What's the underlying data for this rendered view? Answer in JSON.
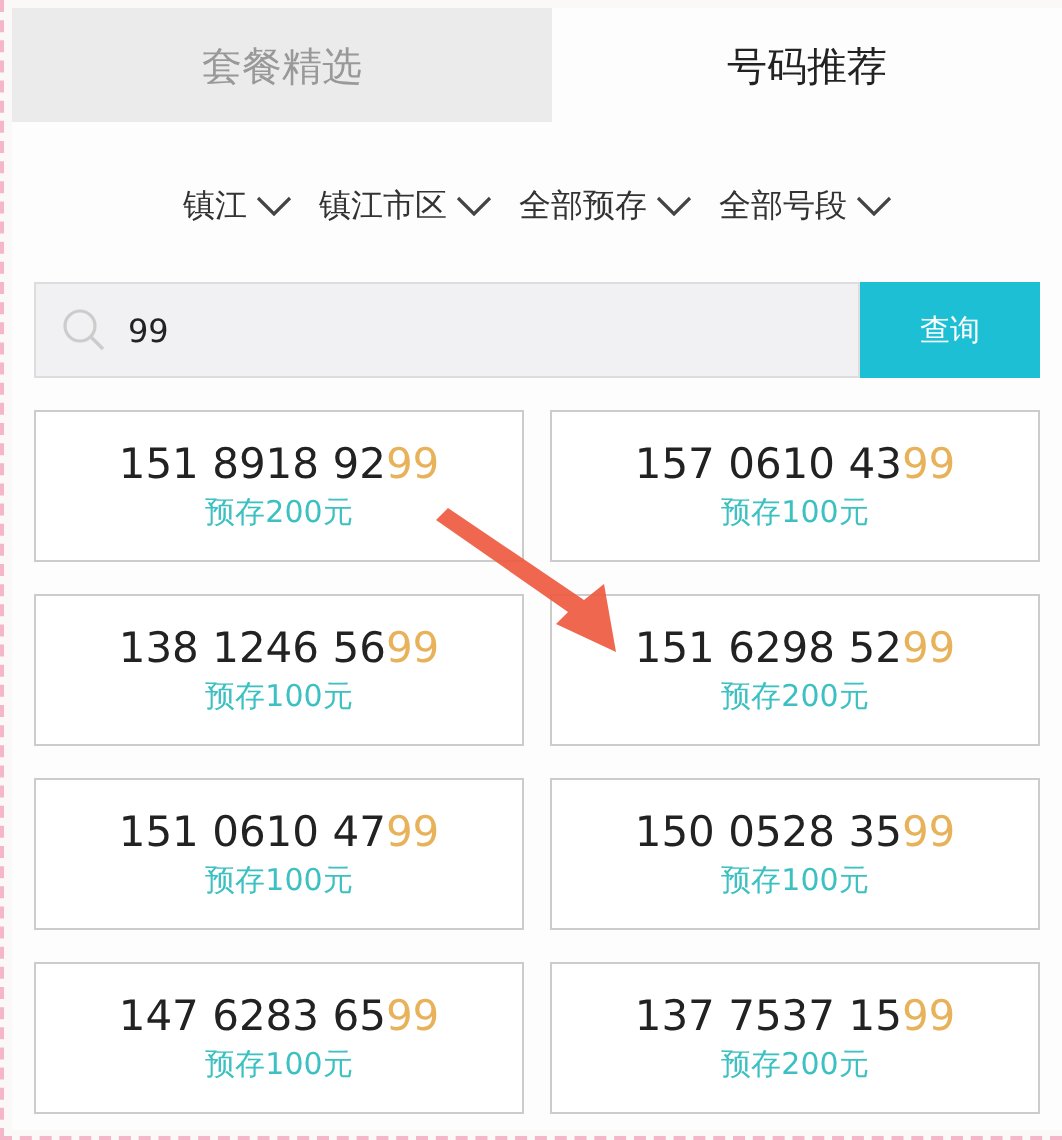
{
  "tabs": [
    {
      "label": "套餐精选",
      "selected": false
    },
    {
      "label": "号码推荐",
      "selected": true
    }
  ],
  "filters": [
    {
      "label": "镇江"
    },
    {
      "label": "镇江市区"
    },
    {
      "label": "全部预存"
    },
    {
      "label": "全部号段"
    }
  ],
  "search": {
    "value": "99",
    "button": "查询"
  },
  "numbers": [
    {
      "number": "151 8918 92",
      "match": "99",
      "deposit": "预存200元"
    },
    {
      "number": "157 0610 43",
      "match": "99",
      "deposit": "预存100元"
    },
    {
      "number": "138 1246 56",
      "match": "99",
      "deposit": "预存100元"
    },
    {
      "number": "151 6298 52",
      "match": "99",
      "deposit": "预存200元"
    },
    {
      "number": "151 0610 47",
      "match": "99",
      "deposit": "预存100元"
    },
    {
      "number": "150 0528 35",
      "match": "99",
      "deposit": "预存100元"
    },
    {
      "number": "147 6283 65",
      "match": "99",
      "deposit": "预存100元"
    },
    {
      "number": "137 7537 15",
      "match": "99",
      "deposit": "预存200元"
    }
  ]
}
